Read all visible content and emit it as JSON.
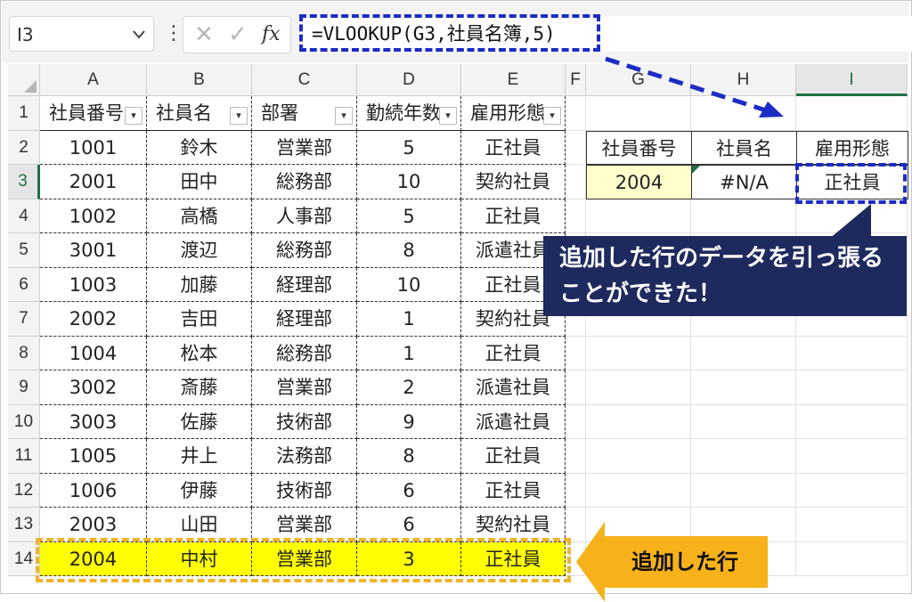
{
  "formula_bar": {
    "name_box": "I3",
    "name_box_icon": "chevron-down-icon",
    "more_icon": "vertical-dots-icon",
    "cancel_icon": "x-icon",
    "confirm_icon": "check-icon",
    "fx_label": "fx",
    "formula": "=VLOOKUP(G3,社員名簿,5)"
  },
  "columns": [
    "A",
    "B",
    "C",
    "D",
    "E",
    "F",
    "G",
    "H",
    "I"
  ],
  "selected_column": "I",
  "selected_row": "3",
  "rows": [
    "1",
    "2",
    "3",
    "4",
    "5",
    "6",
    "7",
    "8",
    "9",
    "10",
    "11",
    "12",
    "13",
    "14"
  ],
  "table": {
    "headers": [
      "社員番号",
      "社員名",
      "部署",
      "勤続年数",
      "雇用形態"
    ],
    "rows": [
      [
        "1001",
        "鈴木",
        "営業部",
        "5",
        "正社員"
      ],
      [
        "2001",
        "田中",
        "総務部",
        "10",
        "契約社員"
      ],
      [
        "1002",
        "高橋",
        "人事部",
        "5",
        "正社員"
      ],
      [
        "3001",
        "渡辺",
        "総務部",
        "8",
        "派遣社員"
      ],
      [
        "1003",
        "加藤",
        "経理部",
        "10",
        "正社員"
      ],
      [
        "2002",
        "吉田",
        "経理部",
        "1",
        "契約社員"
      ],
      [
        "1004",
        "松本",
        "総務部",
        "1",
        "正社員"
      ],
      [
        "3002",
        "斎藤",
        "営業部",
        "2",
        "派遣社員"
      ],
      [
        "3003",
        "佐藤",
        "技術部",
        "9",
        "派遣社員"
      ],
      [
        "1005",
        "井上",
        "法務部",
        "8",
        "正社員"
      ],
      [
        "1006",
        "伊藤",
        "技術部",
        "6",
        "正社員"
      ],
      [
        "2003",
        "山田",
        "営業部",
        "6",
        "契約社員"
      ],
      [
        "2004",
        "中村",
        "営業部",
        "3",
        "正社員"
      ]
    ]
  },
  "lookup": {
    "headers": [
      "社員番号",
      "社員名",
      "雇用形態"
    ],
    "values": [
      "2004",
      "#N/A",
      "正社員"
    ]
  },
  "callout_text": "追加した行のデータを引っ張ることができた！",
  "added_row_label": "追加した行",
  "colors": {
    "highlight_blue": "#1c2cc4",
    "callout_navy": "#1e2a5e",
    "highlight_yellow": "#ffff00",
    "label_orange": "#f7b21b",
    "excel_green": "#1e7145"
  }
}
